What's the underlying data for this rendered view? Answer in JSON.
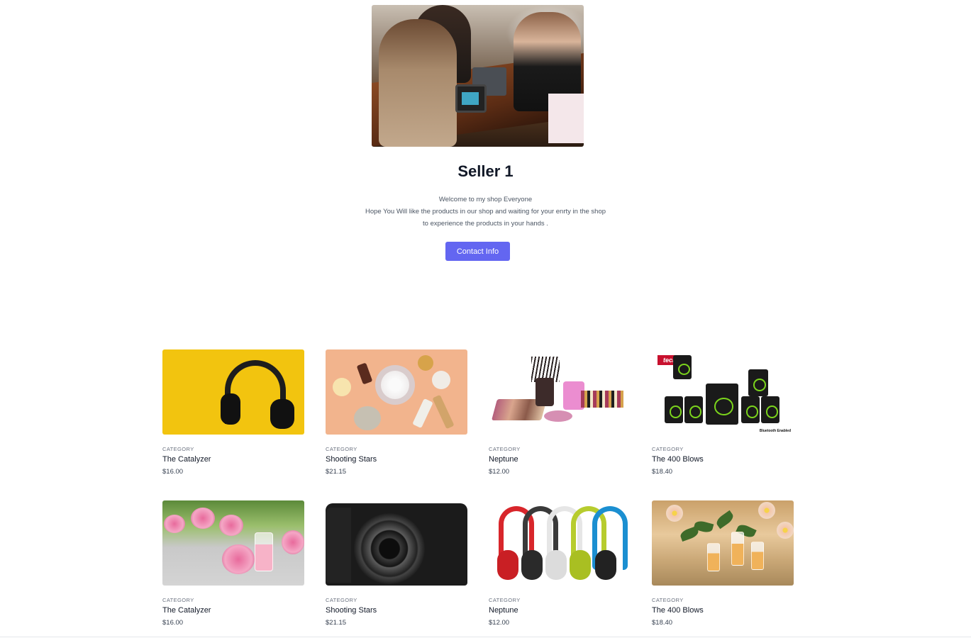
{
  "seller": {
    "name": "Seller 1",
    "description_lines": [
      "Welcome to my shop Everyone",
      "Hope You Will like the products in our shop and waiting for your enrty in the shop",
      "to experience the products in your hands ."
    ],
    "contact_label": "Contact Info"
  },
  "products": [
    {
      "category": "CATEGORY",
      "name": "The Catalyzer",
      "price": "$16.00",
      "image": "yellow-headphones"
    },
    {
      "category": "CATEGORY",
      "name": "Shooting Stars",
      "price": "$21.15",
      "image": "beauty-products"
    },
    {
      "category": "CATEGORY",
      "name": "Neptune",
      "price": "$12.00",
      "image": "makeup-kit"
    },
    {
      "category": "CATEGORY",
      "name": "The 400 Blows",
      "price": "$18.40",
      "image": "home-theater-speakers"
    },
    {
      "category": "CATEGORY",
      "name": "The Catalyzer",
      "price": "$16.00",
      "image": "rose-perfume"
    },
    {
      "category": "CATEGORY",
      "name": "Shooting Stars",
      "price": "$21.15",
      "image": "camera"
    },
    {
      "category": "CATEGORY",
      "name": "Neptune",
      "price": "$12.00",
      "image": "colorful-headphones"
    },
    {
      "category": "CATEGORY",
      "name": "The 400 Blows",
      "price": "$18.40",
      "image": "essential-oils"
    }
  ],
  "image_text": {
    "speakers_logo": "tecnia",
    "speakers_badge": "Bluetooth Enabled"
  },
  "colors": {
    "accent": "#6366f1"
  }
}
